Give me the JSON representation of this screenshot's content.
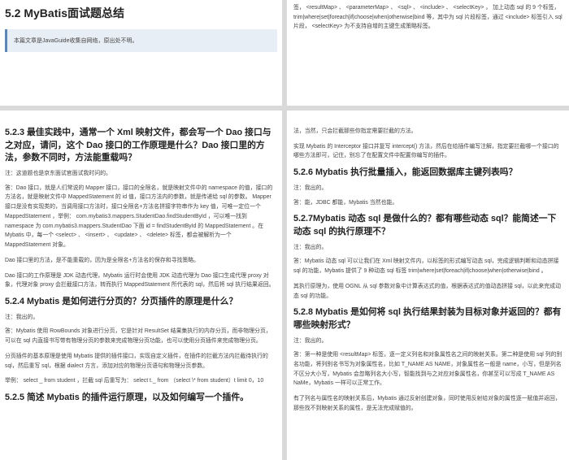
{
  "p1": {
    "title": "5.2 MyBatis面试题总结",
    "callout": "本篇文章是JavaGuide收集自网络，原出处不明。"
  },
  "p2": {
    "line1": "签， <resultMap> 、 <parameterMap> 、 <sql> 、 <include> 、 <selectKey> ， 加上动态 sql 的 9 个标签， trim|where|set|foreach|if|choose|when|otherwise|bind 等，其中为 sql 片段标签，通过 <include> 标签引入 sql 片段， <selectKey> 为不支持自增的主键生成策略标签。"
  },
  "p3": {
    "h_523": "5.2.3 最佳实践中，通常一个 Xml 映射文件，都会写一个 Dao 接口与之对应，请问，这个 Dao 接口的工作原理是什么？Dao 接口里的方法，参数不同时，方法能重载吗？",
    "note_523": "注：这道题也是京东面试官面试我时问的。",
    "a_523_1": "答：Dao 接口，就是人们常说的 Mapper 接口，接口的全限名，就是映射文件中的 namespace 的值，接口的方法名，就是映射文件中 MappedStatement 的 id 值，接口方法内的参数，就是传递给 sql 的参数。 Mapper 接口是没有实现类的，当调用接口方法时，接口全限名+方法名拼接字符串作为 key 值，可唯一定位一个 MappedStatement ，举例： com.mybatis3.mappers.StudentDao.findStudentById ，可以唯一找到 namespace 为 com.mybatis3.mappers.StudentDao 下面 id = findStudentById 的 MappedStatement 。在 Mybatis 中，每一个 <select> 、 <insert> 、 <update> 、 <delete> 标签，都会被解析为一个 MappedStatement 对象。",
    "a_523_2": "Dao 接口里的方法，是不能重载的，因为是全限名+方法名的保存和寻找策略。",
    "a_523_3": "Dao 接口的工作原理是 JDK 动态代理，Mybatis 运行时会使用 JDK 动态代理为 Dao 接口生成代理 proxy 对象，代理对象 proxy 会拦截接口方法，转而执行 MappedStatement 所代表的 sql，然后将 sql 执行结果返回。",
    "h_524": "5.2.4 Mybatis 是如何进行分页的？分页插件的原理是什么？",
    "note_524": "注：我出的。",
    "a_524_1": "答：Mybatis 使用 RowBounds 对象进行分页，它是针对 ResultSet 结果集执行的内存分页，而非物理分页，可以在 sql 内直接书写带有物理分页的参数来完成物理分页功能，也可以使用分页插件来完成物理分页。",
    "a_524_2": "分页插件的基本原理是使用 Mybatis 提供的插件接口，实现自定义插件，在插件的拦截方法内拦截待执行的 sql，然后重写 sql，根据 dialect 方言，添加对应的物理分页语句和物理分页参数。",
    "a_524_3": "举例： select _ from student ，拦截 sql 后重写为： select t._ from （select \\* from student）t limit 0，10",
    "h_525": "5.2.5 简述 Mybatis 的插件运行原理，以及如何编写一个插件。"
  },
  "p4": {
    "line1": "法，当然，只会拦截那些你指定需要拦截的方法。",
    "line2": "实现 Mybatis 的 Interceptor 接口并复写 intercept() 方法，然后在给插件编写注解，指定要拦截哪一个接口的哪些方法即可，记住，别忘了在配置文件中配置你编写的插件。",
    "h_526": "5.2.6 Mybatis 执行批量插入，能返回数据库主键列表吗？",
    "note_526": "注：我出的。",
    "a_526": "答：能，JDBC 都能，Mybatis 当然也能。",
    "h_527": "5.2.7Mybatis 动态 sql 是做什么的？都有哪些动态 sql？能简述一下动态 sql 的执行原理不？",
    "note_527": "注：我出的。",
    "a_527_1": "答：Mybatis 动态 sql 可以让我们在 Xml 映射文件内，以标签的形式编写动态 sql，完成逻辑判断和动态拼接 sql 的功能，Mybatis 提供了 9 种动态 sql 标签 trim|where|set|foreach|if|choose|when|otherwise|bind 。",
    "a_527_2": "其执行原理为，使用 OGNL 从 sql 参数对象中计算表达式的值，根据表达式的值动态拼接 sql，以此来完成动态 sql 的功能。",
    "h_528": "5.2.8 Mybatis 是如何将 sql 执行结果封装为目标对象并返回的？都有哪些映射形式？",
    "note_528": "注：我出的。",
    "a_528_1": "答：第一种是使用 <resultMap> 标签，逐一定义列名和对象属性名之间的映射关系。第二种是使用 sql 列的别名功能，将列别名书写为对象属性名，比如 T_NAME AS NAME，对象属性名一般是 name，小写，但是列名不区分大小写，Mybatis 会忽略列名大小写，智能找到与之对应对象属性名，你甚至可以写成 T_NAME AS NaMe，Mybatis 一样可以正常工作。",
    "a_528_2": "有了列名与属性名的映射关系后，Mybatis 通过反射创建对象，同时使用反射给对象的属性逐一赋值并返回，那些找不到映射关系的属性，是无法完成赋值的。"
  }
}
